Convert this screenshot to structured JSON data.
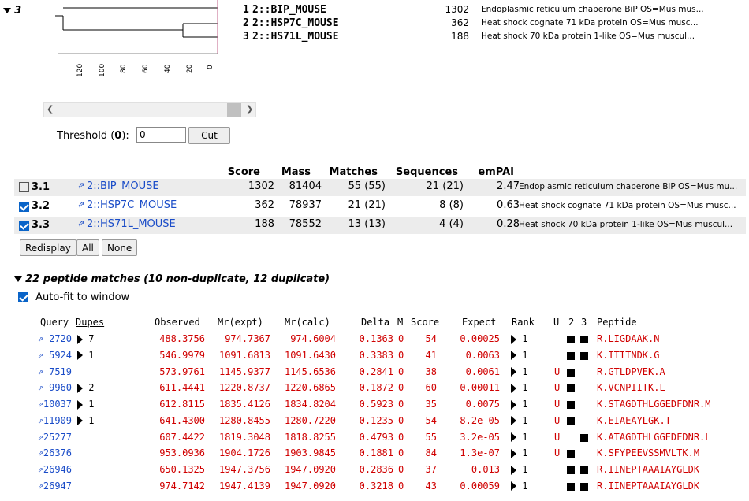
{
  "cluster": {
    "label": "3"
  },
  "tree_hits": [
    {
      "num": "1",
      "name": "2::BIP_MOUSE",
      "score": "1302",
      "desc": "Endoplasmic reticulum chaperone BiP OS=Mus mus..."
    },
    {
      "num": "2",
      "name": "2::HSP7C_MOUSE",
      "score": "362",
      "desc": "Heat shock cognate 71 kDa protein OS=Mus musc..."
    },
    {
      "num": "3",
      "name": "2::HS71L_MOUSE",
      "score": "188",
      "desc": "Heat shock 70 kDa protein 1-like OS=Mus muscul..."
    }
  ],
  "axis_ticks": [
    "120",
    "100",
    "80",
    "60",
    "40",
    "20",
    "0"
  ],
  "threshold": {
    "label_pre": "Threshold (",
    "label_bold": "0",
    "label_post": "):",
    "value": "0",
    "cut_label": "Cut"
  },
  "protein_table": {
    "headers": {
      "score": "Score",
      "mass": "Mass",
      "matches": "Matches",
      "sequences": "Sequences",
      "empai": "emPAI"
    },
    "rows": [
      {
        "id": "3.1",
        "checked": false,
        "name": "2::BIP_MOUSE",
        "score": "1302",
        "mass": "81404",
        "matches": "55 (55)",
        "sequences": "21 (21)",
        "empai": "2.47",
        "desc": "Endoplasmic reticulum chaperone BiP OS=Mus mu..."
      },
      {
        "id": "3.2",
        "checked": true,
        "name": "2::HSP7C_MOUSE",
        "score": "362",
        "mass": "78937",
        "matches": "21 (21)",
        "sequences": "8 (8)",
        "empai": "0.63",
        "desc": "Heat shock cognate 71 kDa protein OS=Mus musc..."
      },
      {
        "id": "3.3",
        "checked": true,
        "name": "2::HS71L_MOUSE",
        "score": "188",
        "mass": "78552",
        "matches": "13 (13)",
        "sequences": "4 (4)",
        "empai": "0.28",
        "desc": "Heat shock 70 kDa protein 1-like OS=Mus muscul..."
      }
    ]
  },
  "buttons": {
    "redisplay": "Redisplay",
    "all": "All",
    "none": "None"
  },
  "peptide_section": {
    "title": "22 peptide matches (10 non-duplicate, 12 duplicate)",
    "autofit": "Auto-fit to window"
  },
  "peptide_headers": {
    "query": "Query",
    "dupes": "Dupes",
    "observed": "Observed",
    "mr_expt": "Mr(expt)",
    "mr_calc": "Mr(calc)",
    "delta": "Delta",
    "m": "M",
    "score": "Score",
    "expect": "Expect",
    "rank": "Rank",
    "u": "U",
    "c2": "2",
    "c3": "3",
    "peptide": "Peptide"
  },
  "peptides": [
    {
      "query": "2720",
      "dupes": "7",
      "observed": "488.3756",
      "mr_expt": "974.7367",
      "mr_calc": "974.6004",
      "delta": "0.1363",
      "m": "0",
      "score": "54",
      "expect": "0.00025",
      "rank": "1",
      "u": "",
      "c2": true,
      "c3": true,
      "peptide": "R.LIGDAAK.N"
    },
    {
      "query": "5924",
      "dupes": "1",
      "observed": "546.9979",
      "mr_expt": "1091.6813",
      "mr_calc": "1091.6430",
      "delta": "0.3383",
      "m": "0",
      "score": "41",
      "expect": "0.0063",
      "rank": "1",
      "u": "",
      "c2": true,
      "c3": true,
      "peptide": "K.ITITNDK.G"
    },
    {
      "query": "7519",
      "dupes": "",
      "observed": "573.9761",
      "mr_expt": "1145.9377",
      "mr_calc": "1145.6536",
      "delta": "0.2841",
      "m": "0",
      "score": "38",
      "expect": "0.0061",
      "rank": "1",
      "u": "U",
      "c2": true,
      "c3": false,
      "peptide": "R.GTLDPVEK.A"
    },
    {
      "query": "9960",
      "dupes": "2",
      "observed": "611.4441",
      "mr_expt": "1220.8737",
      "mr_calc": "1220.6865",
      "delta": "0.1872",
      "m": "0",
      "score": "60",
      "expect": "0.00011",
      "rank": "1",
      "u": "U",
      "c2": true,
      "c3": false,
      "peptide": "K.VCNPIITK.L"
    },
    {
      "query": "10037",
      "dupes": "1",
      "observed": "612.8115",
      "mr_expt": "1835.4126",
      "mr_calc": "1834.8204",
      "delta": "0.5923",
      "m": "0",
      "score": "35",
      "expect": "0.0075",
      "rank": "1",
      "u": "U",
      "c2": true,
      "c3": false,
      "peptide": "K.STAGDTHLGGEDFDNR.M"
    },
    {
      "query": "11909",
      "dupes": "1",
      "observed": "641.4300",
      "mr_expt": "1280.8455",
      "mr_calc": "1280.7220",
      "delta": "0.1235",
      "m": "0",
      "score": "54",
      "expect": "8.2e-05",
      "rank": "1",
      "u": "U",
      "c2": true,
      "c3": false,
      "peptide": "K.EIAEAYLGK.T"
    },
    {
      "query": "25277",
      "dupes": "",
      "observed": "607.4422",
      "mr_expt": "1819.3048",
      "mr_calc": "1818.8255",
      "delta": "0.4793",
      "m": "0",
      "score": "55",
      "expect": "3.2e-05",
      "rank": "1",
      "u": "U",
      "c2": false,
      "c3": true,
      "peptide": "K.ATAGDTHLGGEDFDNR.L"
    },
    {
      "query": "26376",
      "dupes": "",
      "observed": "953.0936",
      "mr_expt": "1904.1726",
      "mr_calc": "1903.9845",
      "delta": "0.1881",
      "m": "0",
      "score": "84",
      "expect": "1.3e-07",
      "rank": "1",
      "u": "U",
      "c2": true,
      "c3": false,
      "peptide": "K.SFYPEEVSSMVLTK.M"
    },
    {
      "query": "26946",
      "dupes": "",
      "observed": "650.1325",
      "mr_expt": "1947.3756",
      "mr_calc": "1947.0920",
      "delta": "0.2836",
      "m": "0",
      "score": "37",
      "expect": "0.013",
      "rank": "1",
      "u": "",
      "c2": true,
      "c3": true,
      "peptide": "R.IINEPTAAAIAYGLDK"
    },
    {
      "query": "26947",
      "dupes": "",
      "observed": "974.7142",
      "mr_expt": "1947.4139",
      "mr_calc": "1947.0920",
      "delta": "0.3218",
      "m": "0",
      "score": "43",
      "expect": "0.00059",
      "rank": "1",
      "u": "",
      "c2": true,
      "c3": true,
      "peptide": "R.IINEPTAAAIAYGLDK"
    }
  ]
}
